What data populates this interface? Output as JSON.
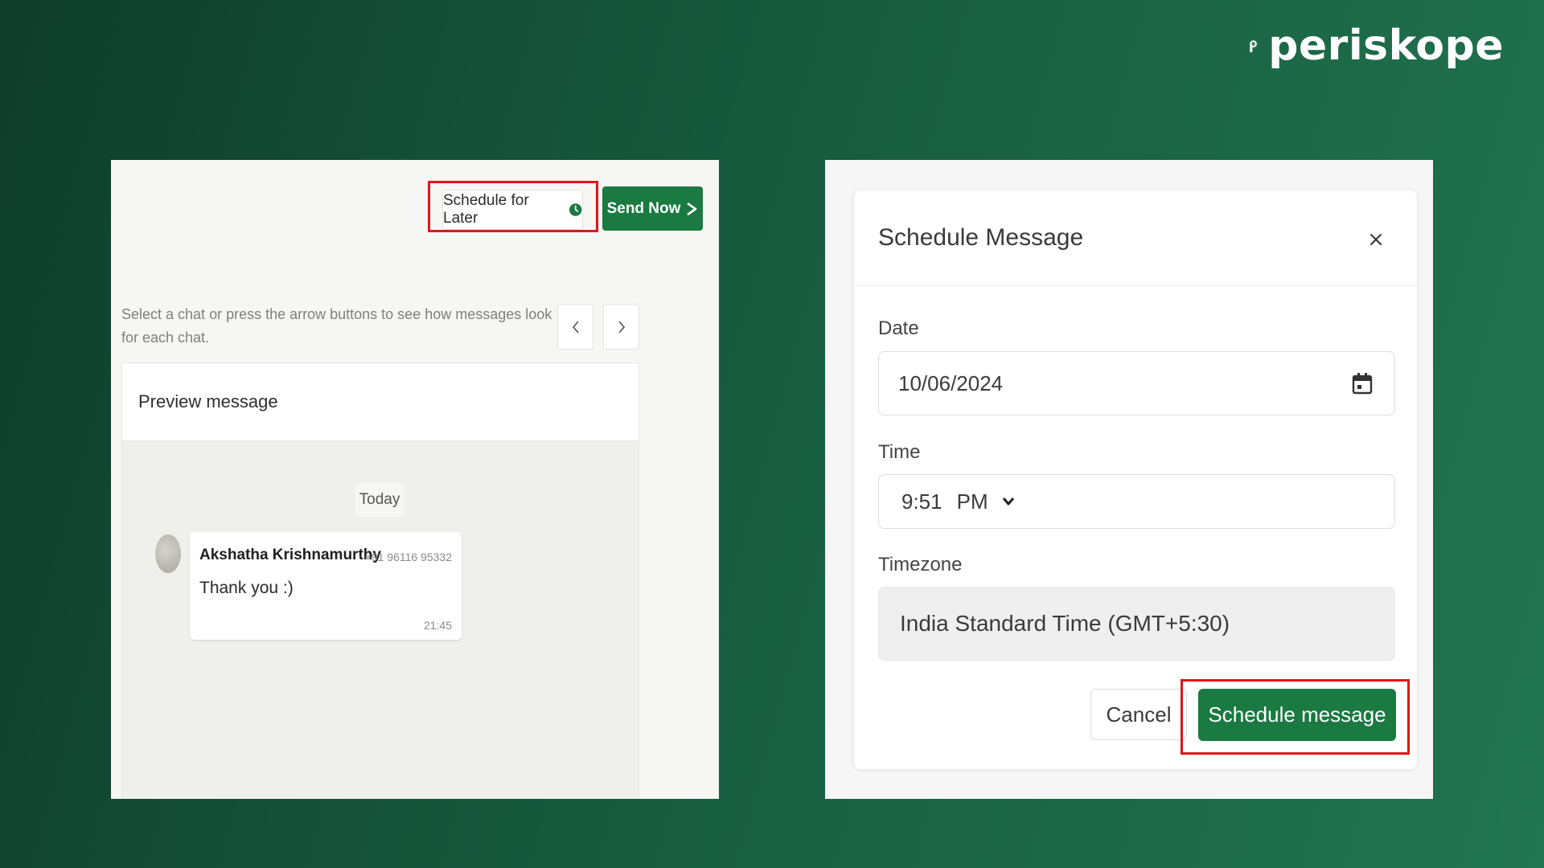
{
  "brand": {
    "name": "periskope"
  },
  "colors": {
    "brand_green": "#1a7a41",
    "highlight_red": "#e3131b",
    "background_dark": "#0f3d2c",
    "background_light": "#217550"
  },
  "left_panel": {
    "schedule_later_label": "Schedule for Later",
    "send_now_label": "Send Now",
    "hint": "Select a chat or press the arrow buttons to see how messages look for each chat.",
    "prev_icon": "chevron-left-icon",
    "next_icon": "chevron-right-icon",
    "preview_title": "Preview message",
    "day_label": "Today",
    "message": {
      "sender": "Akshatha Krishnamurthy",
      "phone": "+91 96116 95332",
      "text": "Thank you :)",
      "time": "21:45"
    }
  },
  "schedule_modal": {
    "title": "Schedule Message",
    "close_icon": "close-icon",
    "date_label": "Date",
    "date_value": "10/06/2024",
    "time_label": "Time",
    "time_value": "9:51",
    "time_period": "PM",
    "timezone_label": "Timezone",
    "timezone_value": "India Standard Time (GMT+5:30)",
    "cancel_label": "Cancel",
    "schedule_label": "Schedule message"
  }
}
